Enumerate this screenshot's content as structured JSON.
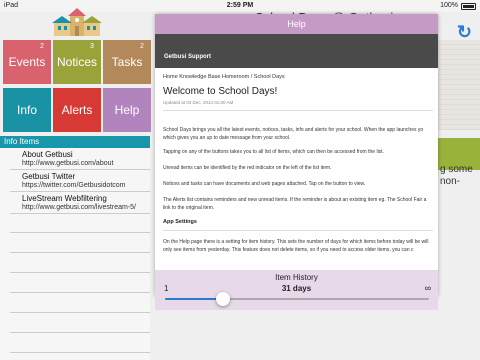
{
  "status_bar": {
    "carrier": "iPad",
    "time": "2:59 PM",
    "battery": "100%"
  },
  "background_title": "School Days @ Getbusi",
  "tiles": {
    "events": {
      "label": "Events",
      "badge": "2"
    },
    "notices": {
      "label": "Notices",
      "badge": "3"
    },
    "tasks": {
      "label": "Tasks",
      "badge": "2"
    },
    "info": {
      "label": "Info"
    },
    "alerts": {
      "label": "Alerts"
    },
    "help": {
      "label": "Help"
    }
  },
  "info_panel": {
    "header": "Info Items",
    "items": [
      {
        "title": "About Getbusi",
        "url": "http://www.getbusi.com/about"
      },
      {
        "title": "Getbusi Twitter",
        "url": "https://twitter.com/Getbusidotcom"
      },
      {
        "title": "LiveStream Webfiltering",
        "url": "http://www.getbusi.com/livestream-5/"
      }
    ]
  },
  "right_text": "g some\nnon-",
  "modal": {
    "title": "Help",
    "support_label": "Getbusi Support",
    "breadcrumbs": "Home   Knowledge Base   Homeroom / School Days",
    "heading": "Welcome to School Days!",
    "updated": "Updated at 03 Dec, 2014 01:00 AM",
    "paragraphs": [
      "School Days brings you all the latest events, notices, tasks, info and alerts for your school. When the app launches yo which gives you an up to date message from your school.",
      "Tapping on any of the buttons takes you to all list of items, which can then be accessed from the list.",
      "Unread items can be identified by the red indicator on the left of the list item.",
      "Notices and tasks can have documents and web pages attached. Tap on the button to view.",
      "The Alerts list contains reminders and new unread items. If the reminder is about an existing item eg. The School Fair a link to the original item."
    ],
    "app_settings_heading": "App Settings",
    "app_settings_text": "On the Help page there is a setting for item history. This sets the number of days for which items before today will be will only see items from yesterday. This feature does not delete items, so if you need to access older items, you can c"
  },
  "item_history": {
    "title": "Item History",
    "min_label": "1",
    "value_label": "31 days",
    "max_label": "∞",
    "slider_fraction": 0.22
  },
  "colors": {
    "events": "#d8626e",
    "notices": "#9aa33a",
    "tasks": "#b3885a",
    "info": "#1992a6",
    "alerts": "#d73a35",
    "help": "#b284bd",
    "modal_header": "#c59ac5",
    "accent": "#2b7bd0"
  }
}
